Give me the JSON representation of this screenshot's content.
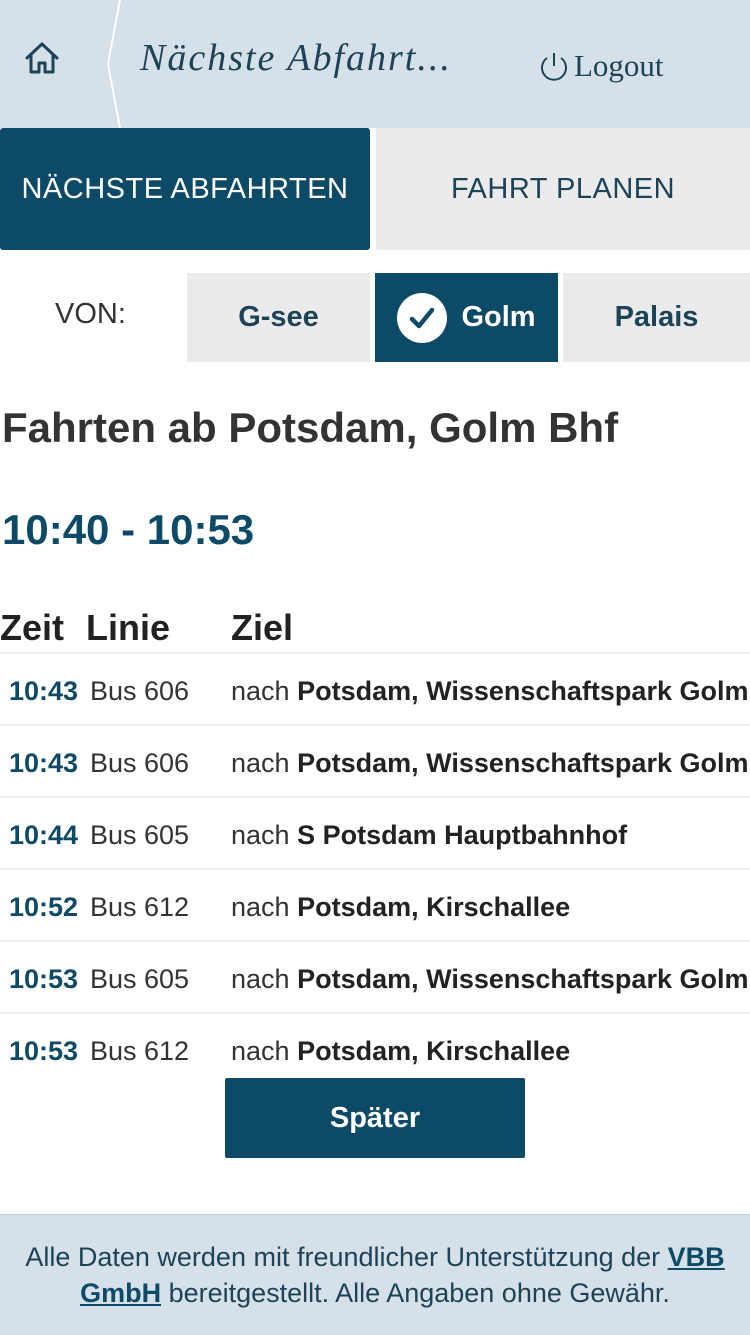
{
  "header": {
    "title": "Nächste Abfahrt...",
    "logout_label": "Logout",
    "home_icon": "home-icon",
    "logout_icon": "power-icon"
  },
  "mode_tabs": [
    {
      "label": "NÄCHSTE ABFAHRTEN",
      "active": true
    },
    {
      "label": "FAHRT PLANEN",
      "active": false
    }
  ],
  "stop_selector": {
    "label": "VON:",
    "stops": [
      {
        "label": "G-see",
        "active": false
      },
      {
        "label": "Golm",
        "active": true
      },
      {
        "label": "Palais",
        "active": false
      }
    ]
  },
  "board": {
    "heading": "Fahrten ab Potsdam, Golm Bhf",
    "time_range": "10:40 - 10:53",
    "columns": {
      "time": "Zeit",
      "line": "Linie",
      "destination": "Ziel"
    },
    "rows": [
      {
        "time": "10:43",
        "line": "Bus 606",
        "prefix": "nach",
        "destination": "Potsdam, Wissenschaftspark Golm"
      },
      {
        "time": "10:43",
        "line": "Bus 606",
        "prefix": "nach",
        "destination": "Potsdam, Wissenschaftspark Golm"
      },
      {
        "time": "10:44",
        "line": "Bus 605",
        "prefix": "nach",
        "destination": "S Potsdam Hauptbahnhof"
      },
      {
        "time": "10:52",
        "line": "Bus 612",
        "prefix": "nach",
        "destination": "Potsdam, Kirschallee"
      },
      {
        "time": "10:53",
        "line": "Bus 605",
        "prefix": "nach",
        "destination": "Potsdam, Wissenschaftspark Golm"
      },
      {
        "time": "10:53",
        "line": "Bus 612",
        "prefix": "nach",
        "destination": "Potsdam, Kirschallee"
      }
    ],
    "later_label": "Später"
  },
  "footer": {
    "text_before": "Alle Daten werden mit freundlicher Unterstützung der ",
    "link": "VBB GmbH",
    "text_after": " bereitgestellt. Alle Angaben ohne Gewähr."
  },
  "colors": {
    "primary": "#0c4a68",
    "header_bg": "#d6e0e8",
    "inactive_bg": "#ebebeb"
  }
}
